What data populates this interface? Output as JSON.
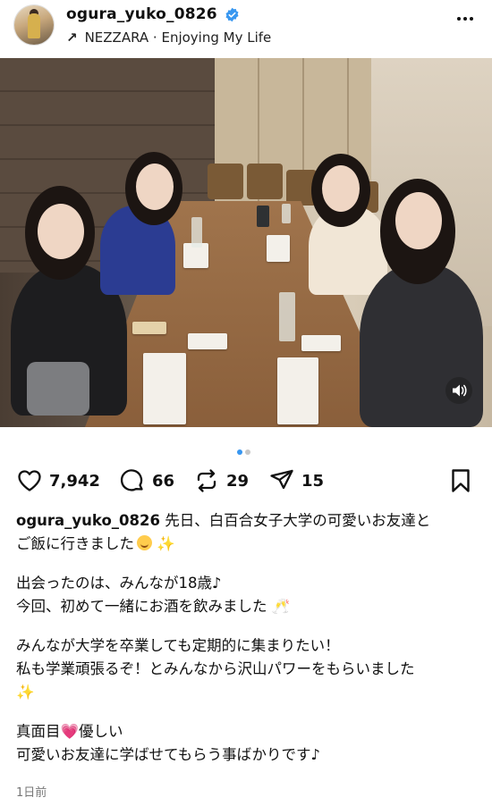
{
  "header": {
    "username": "ogura_yuko_0826",
    "music_line": "NEZZARA · Enjoying My Life"
  },
  "icons": {
    "verified": "verified-badge-icon",
    "more": "more-options-icon",
    "like": "heart-icon",
    "comment": "comment-icon",
    "repost": "repost-icon",
    "share": "send-icon",
    "save": "bookmark-icon",
    "sound": "speaker-icon"
  },
  "carousel": {
    "total": 2,
    "active": 1
  },
  "stats": {
    "likes": "7,942",
    "comments": "66",
    "reposts": "29",
    "shares": "15"
  },
  "caption": {
    "username": "ogura_yuko_0826",
    "line1": " 先日、白百合女子大学の可愛いお友達と",
    "line2": "ご飯に行きました",
    "para2_line1": "出会ったのは、みんなが18歳♪",
    "para2_line2": "今回、初めて一緒にお酒を飲みました",
    "para3_line1": "みんなが大学を卒業しても定期的に集まりたい！",
    "para3_line2": "私も学業頑張るぞ！とみんなから沢山パワーをもらいました",
    "para4_line1a": "真面目",
    "para4_line1b": "優しい",
    "para4_line2": "可愛いお友達に学ばせてもらう事ばかりです♪"
  },
  "timestamp": "1日前",
  "colors": {
    "verified": "#3897f0",
    "dot_active": "#3897f0",
    "dot_inactive": "#c7c7c7"
  }
}
